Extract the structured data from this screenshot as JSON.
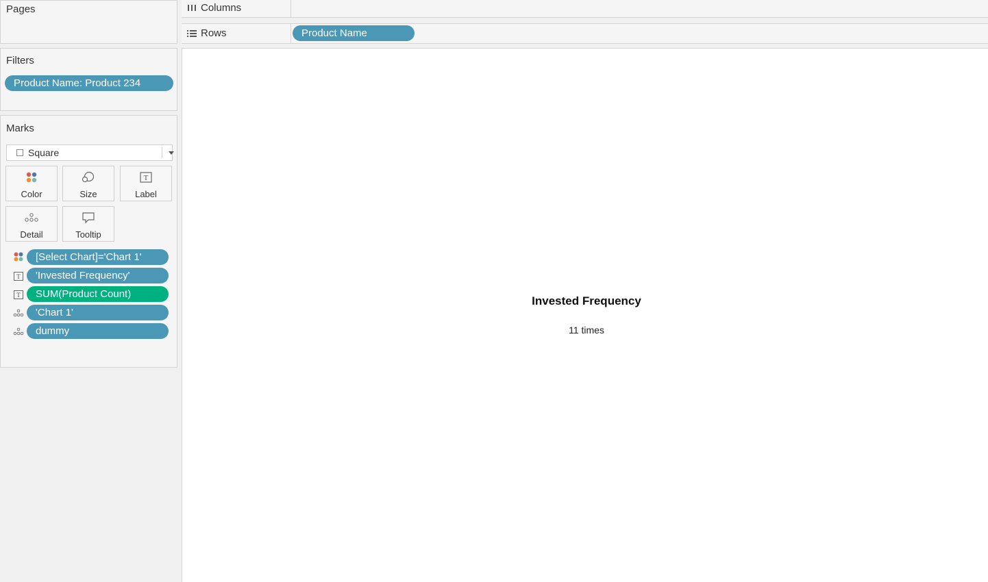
{
  "pages": {
    "title": "Pages"
  },
  "filters": {
    "title": "Filters",
    "pills": [
      "Product Name: Product 234"
    ]
  },
  "marks": {
    "title": "Marks",
    "mark_type": "Square",
    "buttons": {
      "color": "Color",
      "size": "Size",
      "label": "Label",
      "detail": "Detail",
      "tooltip": "Tooltip"
    },
    "fields": [
      {
        "label": "[Select Chart]='Chart 1'",
        "encoding": "color-icon",
        "color": "#4a97b6"
      },
      {
        "label": "'Invested Frequency'",
        "encoding": "label-icon",
        "color": "#4a97b6"
      },
      {
        "label": "SUM(Product Count)",
        "encoding": "label-icon",
        "color": "#00b180"
      },
      {
        "label": "'Chart 1'",
        "encoding": "detail-icon",
        "color": "#4a97b6"
      },
      {
        "label": "dummy",
        "encoding": "detail-icon",
        "color": "#4a97b6"
      }
    ]
  },
  "shelves": {
    "columns": {
      "title": "Columns"
    },
    "rows": {
      "title": "Rows",
      "pills": [
        "Product Name"
      ]
    }
  },
  "viz": {
    "title": "Invested Frequency",
    "value": "11 times"
  }
}
